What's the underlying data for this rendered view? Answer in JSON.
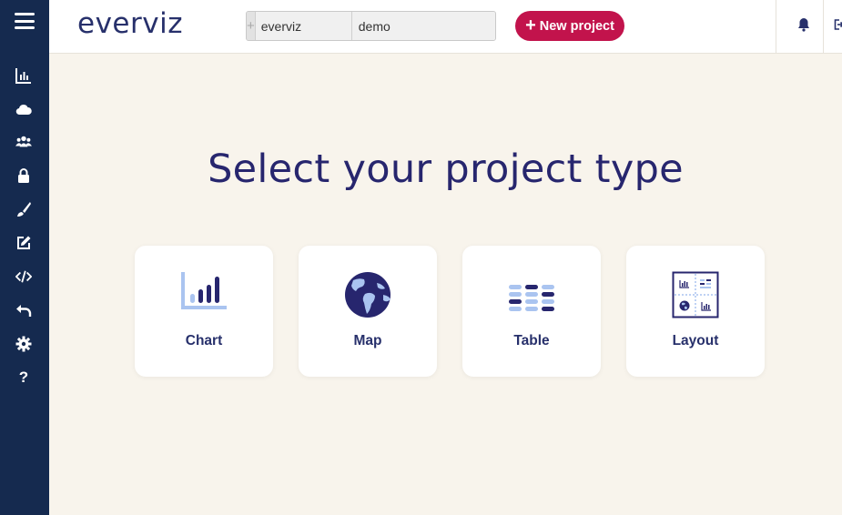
{
  "app": {
    "logo": "everviz"
  },
  "header": {
    "search": {
      "plus": "+",
      "field1": "everviz",
      "field2": "demo"
    },
    "new_project": {
      "plus": "+",
      "label": "New project"
    }
  },
  "sidebar": {
    "items": [
      {
        "icon": "chart-icon"
      },
      {
        "icon": "cloud-icon"
      },
      {
        "icon": "users-icon"
      },
      {
        "icon": "lock-icon"
      },
      {
        "icon": "brush-icon"
      },
      {
        "icon": "edit-icon"
      },
      {
        "icon": "code-icon"
      },
      {
        "icon": "undo-icon"
      },
      {
        "icon": "gear-icon"
      },
      {
        "icon": "help-icon",
        "label": "?"
      }
    ]
  },
  "main": {
    "title": "Select your project type",
    "cards": [
      {
        "label": "Chart"
      },
      {
        "label": "Map"
      },
      {
        "label": "Table"
      },
      {
        "label": "Layout"
      }
    ]
  },
  "colors": {
    "sidebar": "#152a4f",
    "accent": "#c2134c",
    "brand": "#27306b",
    "background": "#f8f4ec",
    "icon_light": "#aac4f0"
  }
}
